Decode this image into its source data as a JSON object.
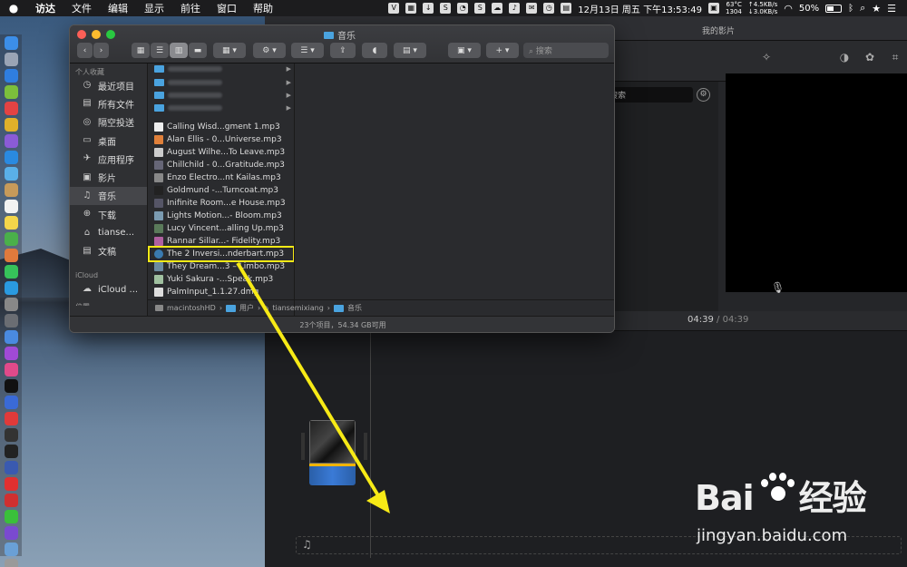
{
  "menubar": {
    "apple": "",
    "menus": [
      "访达",
      "文件",
      "编辑",
      "显示",
      "前往",
      "窗口",
      "帮助"
    ],
    "datetime": "12月13日 周五 下午13:53:49",
    "temp_line1": "63°C",
    "temp_line2": "1304",
    "net_line1": "↑4.5KB/s",
    "net_line2": "↓3.0KB/s",
    "battery": "50%",
    "battery_level": 0.5
  },
  "imovie": {
    "window_title": "我的影片",
    "search_text": "搜索",
    "timecode_current": "04:39",
    "timecode_sep": "/",
    "timecode_total": "04:39"
  },
  "finder": {
    "title": "音乐",
    "search_placeholder": "搜索",
    "sidebar_head_fav": "个人收藏",
    "sidebar": [
      {
        "label": "最近项目",
        "icon": "clock-icon"
      },
      {
        "label": "所有文件",
        "icon": "files-icon"
      },
      {
        "label": "隔空投送",
        "icon": "airdrop-icon"
      },
      {
        "label": "桌面",
        "icon": "desktop-icon"
      },
      {
        "label": "应用程序",
        "icon": "apps-icon"
      },
      {
        "label": "影片",
        "icon": "film-icon"
      },
      {
        "label": "音乐",
        "icon": "music-icon"
      },
      {
        "label": "下载",
        "icon": "download-icon"
      },
      {
        "label": "tianse...",
        "icon": "home-icon"
      },
      {
        "label": "文稿",
        "icon": "doc-icon"
      }
    ],
    "sidebar_head_icloud": "iCloud",
    "icloud_item": "iCloud ...",
    "sidebar_head_loc": "位置",
    "files": [
      "Calling Wisd...gment 1.mp3",
      "Alan Ellis - 0...Universe.mp3",
      "August Wilhe...To Leave.mp3",
      "Chillchild - 0...Gratitude.mp3",
      "Enzo Electro...nt Kailas.mp3",
      "Goldmund -...Turncoat.mp3",
      "Inifinite Room...e House.mp3",
      "Lights Motion...- Bloom.mp3",
      "Lucy Vincent...alling Up.mp3",
      "Rannar Sillar...- Fidelity.mp3",
      "The 2 Inversi...nderbart.mp3",
      "They Dream...3 – Limbo.mp3",
      "Yuki Sakura -...Speak.mp3",
      "PalmInput_1.1.27.dmg"
    ],
    "highlighted_file": "The 2 Inversi...nderbart.mp3",
    "path": [
      "macintoshHD",
      "用户",
      "tiansemixiang",
      "音乐"
    ],
    "path_sep": "›",
    "status": "23个项目，54.34 GB可用"
  },
  "watermark": {
    "logo_left": "Bai",
    "logo_right": "经验",
    "url": "jingyan.baidu.com"
  },
  "colors": {
    "highlight": "#f7ea16",
    "arrow": "#f7ea16",
    "folder": "#4aa3df"
  }
}
